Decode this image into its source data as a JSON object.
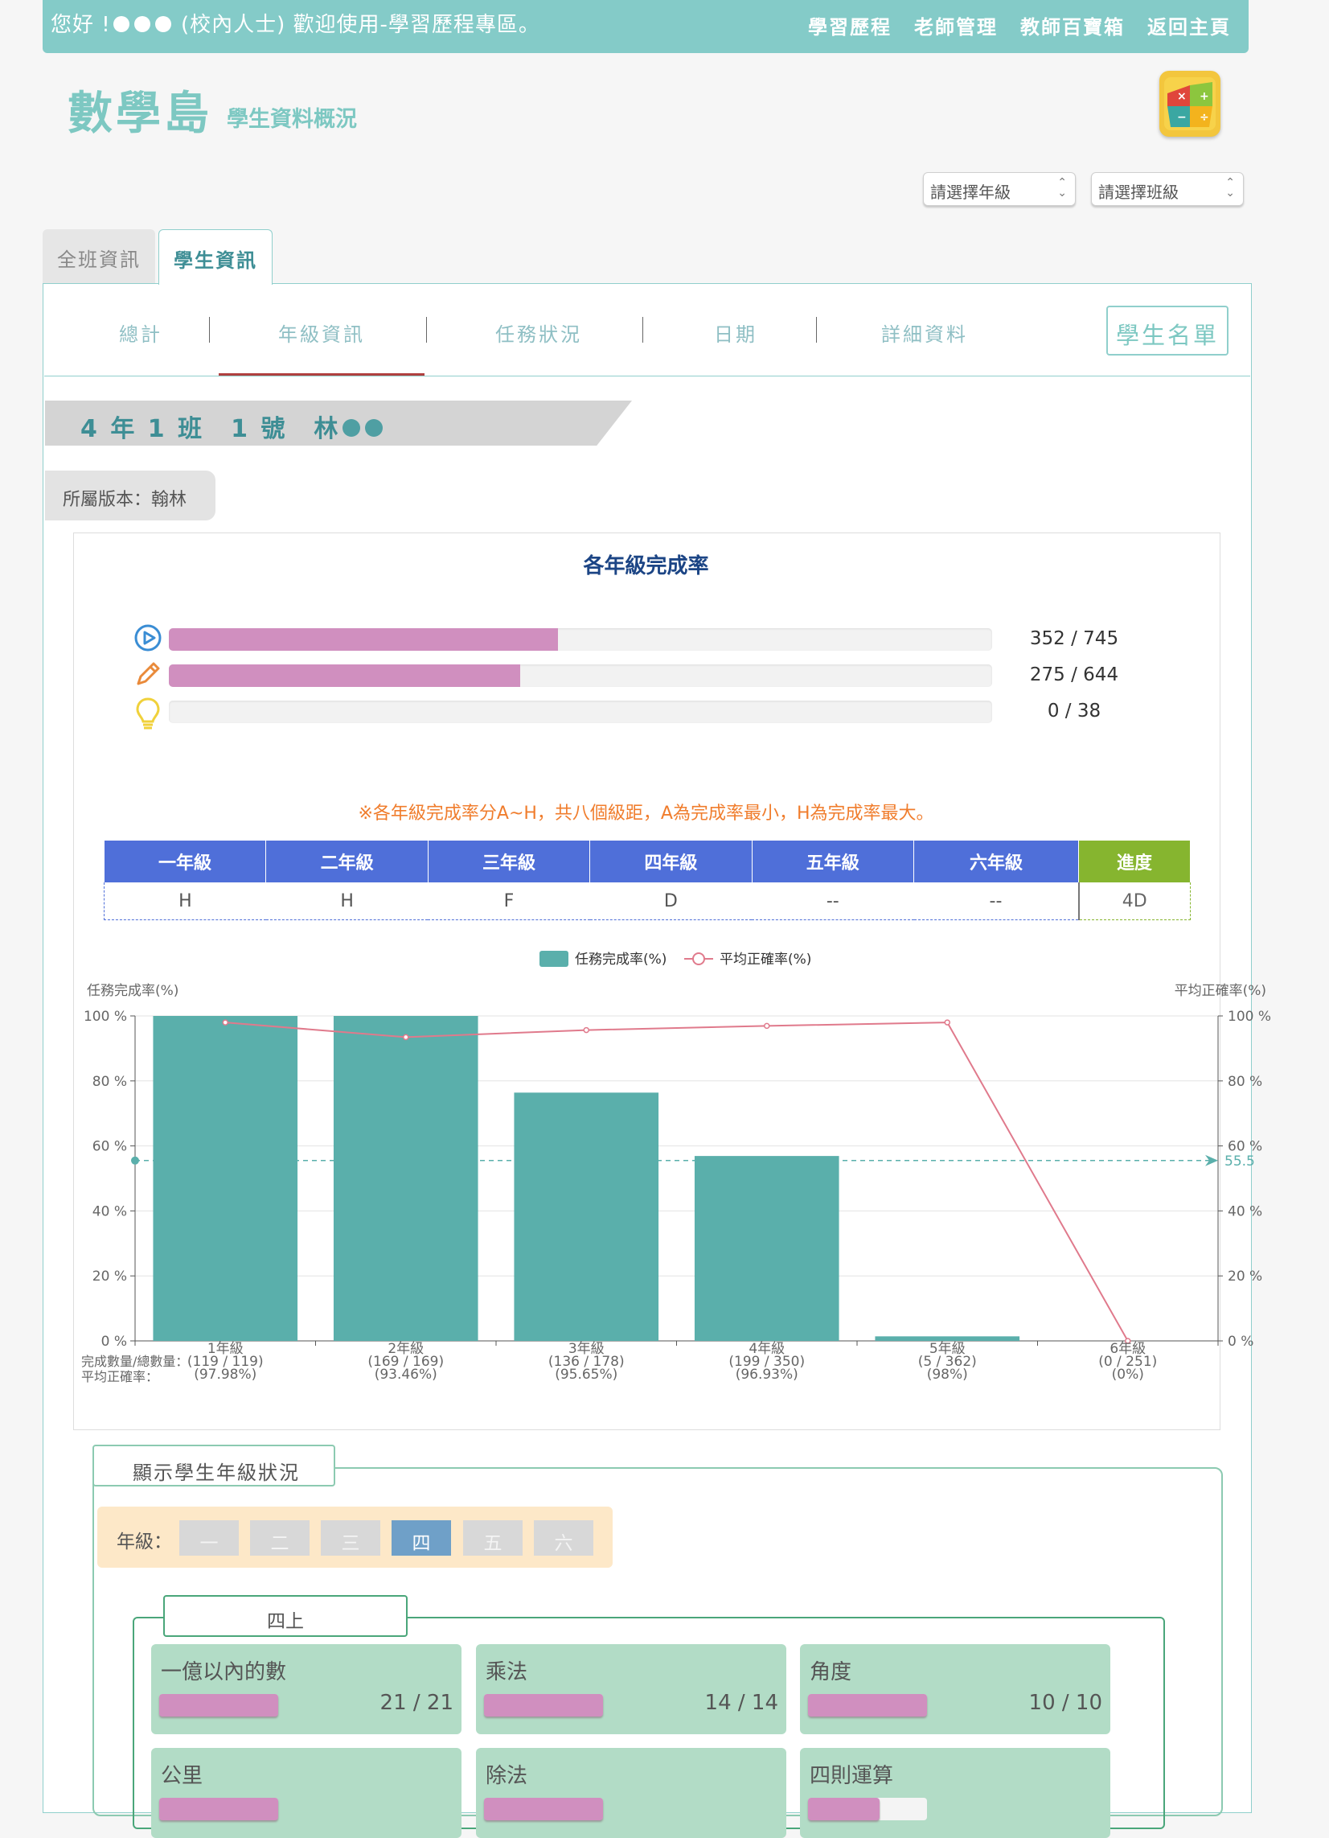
{
  "topbar": {
    "greet_prefix": "您好 !",
    "greet_suffix": "(校內人士) 歡迎使用-學習歷程專區。",
    "nav": [
      "學習歷程",
      "老師管理",
      "教師百寶箱",
      "返回主頁"
    ]
  },
  "brand": {
    "title": "數學島",
    "subtitle": "學生資料概況"
  },
  "selects": {
    "grade": "請選擇年級",
    "class": "請選擇班級"
  },
  "tabs": [
    "全班資訊",
    "學生資訊"
  ],
  "subnav": {
    "items": [
      "總計",
      "年級資訊",
      "任務狀況",
      "日期",
      "詳細資料"
    ],
    "active_index": 1,
    "roster_button": "學生名單"
  },
  "student": {
    "name_prefix": "4 年 1 班　1 號　林",
    "edition": "所屬版本：翰林"
  },
  "completion": {
    "title": "各年級完成率",
    "rows": [
      {
        "icon": "video-play-icon",
        "done": 352,
        "total": 745,
        "label": "352 / 745"
      },
      {
        "icon": "pencil-icon",
        "done": 275,
        "total": 644,
        "label": "275 / 644"
      },
      {
        "icon": "lightbulb-icon",
        "done": 0,
        "total": 38,
        "label": "0 / 38"
      }
    ],
    "note": "※各年級完成率分A~H，共八個級距，A為完成率最小，H為完成率最大。"
  },
  "grade_table": {
    "headers": [
      "一年級",
      "二年級",
      "三年級",
      "四年級",
      "五年級",
      "六年級",
      "進度"
    ],
    "values": [
      "H",
      "H",
      "F",
      "D",
      "--",
      "--",
      "4D"
    ]
  },
  "chart_data": {
    "type": "bar",
    "legend": [
      "任務完成率(%)",
      "平均正確率(%)"
    ],
    "ylabel_left": "任務完成率(%)",
    "ylabel_right": "平均正確率(%)",
    "yticks": [
      "0 %",
      "20 %",
      "40 %",
      "60 %",
      "80 %",
      "100 %"
    ],
    "ylim": [
      0,
      100
    ],
    "categories": [
      "1年級",
      "2年級",
      "3年級",
      "4年級",
      "5年級",
      "6年級"
    ],
    "counts": [
      "(119 / 119)",
      "(169 / 169)",
      "(136 / 178)",
      "(199 / 350)",
      "(5 / 362)",
      "(0 / 251)"
    ],
    "accuracy_labels": [
      "(97.98%)",
      "(93.46%)",
      "(95.65%)",
      "(96.93%)",
      "(98%)",
      "(0%)"
    ],
    "row_labels": [
      "完成數量/總數量：",
      "平均正確率："
    ],
    "series": [
      {
        "name": "任務完成率(%)",
        "type": "bar",
        "color": "#5aafab",
        "values": [
          100,
          100,
          76.4,
          56.9,
          1.4,
          0
        ]
      },
      {
        "name": "平均正確率(%)",
        "type": "line",
        "color": "#e07a8c",
        "values": [
          97.98,
          93.46,
          95.65,
          96.93,
          98,
          0
        ]
      }
    ],
    "reference_line": {
      "value": 55.5,
      "label": "55.5",
      "color": "#5aafab"
    },
    "grid": true
  },
  "grade_status": {
    "legend": "顯示學生年級狀況",
    "label": "年級：",
    "buttons": [
      "一",
      "二",
      "三",
      "四",
      "五",
      "六"
    ],
    "active_index": 3,
    "semester": "四上",
    "units": [
      {
        "name": "一億以內的數",
        "count": "21 / 21",
        "progress": 1
      },
      {
        "name": "乘法",
        "count": "14 / 14",
        "progress": 1
      },
      {
        "name": "角度",
        "count": "10 / 10",
        "progress": 1
      },
      {
        "name": "公里",
        "count": "",
        "progress": 1
      },
      {
        "name": "除法",
        "count": "",
        "progress": 1
      },
      {
        "name": "四則運算",
        "count": "",
        "progress": 0.6
      }
    ]
  }
}
